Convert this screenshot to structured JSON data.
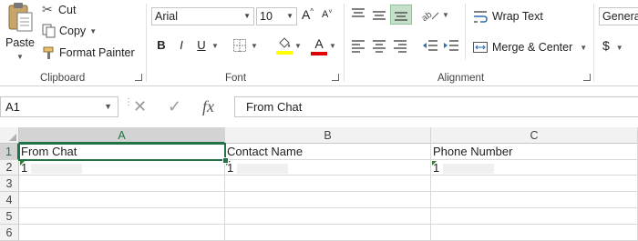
{
  "clipboard": {
    "paste_label": "Paste",
    "cut_label": "Cut",
    "copy_label": "Copy",
    "format_painter_label": "Format Painter",
    "group_label": "Clipboard"
  },
  "font": {
    "font_name": "Arial",
    "font_size": "10",
    "grow_label": "A",
    "shrink_label": "A",
    "bold_label": "B",
    "italic_label": "I",
    "underline_label": "U",
    "font_color_label": "A",
    "group_label": "Font"
  },
  "alignment": {
    "wrap_text_label": "Wrap Text",
    "merge_center_label": "Merge & Center",
    "group_label": "Alignment"
  },
  "number": {
    "format_value": "Genera",
    "currency_symbol": "$"
  },
  "formula_bar": {
    "name_box": "A1",
    "fx_label": "fx",
    "formula_value": "From Chat"
  },
  "sheet": {
    "columns": [
      "A",
      "B",
      "C"
    ],
    "rows": [
      "1",
      "2",
      "3",
      "4",
      "5",
      "6"
    ],
    "cells": {
      "A1": "From Chat",
      "B1": "Contact Name",
      "C1": "Phone Number",
      "A2": "1",
      "B2": "1",
      "C2": "1"
    }
  },
  "colors": {
    "accent": "#217346",
    "fill_color": "#FFFF00",
    "font_color": "#E00000"
  }
}
